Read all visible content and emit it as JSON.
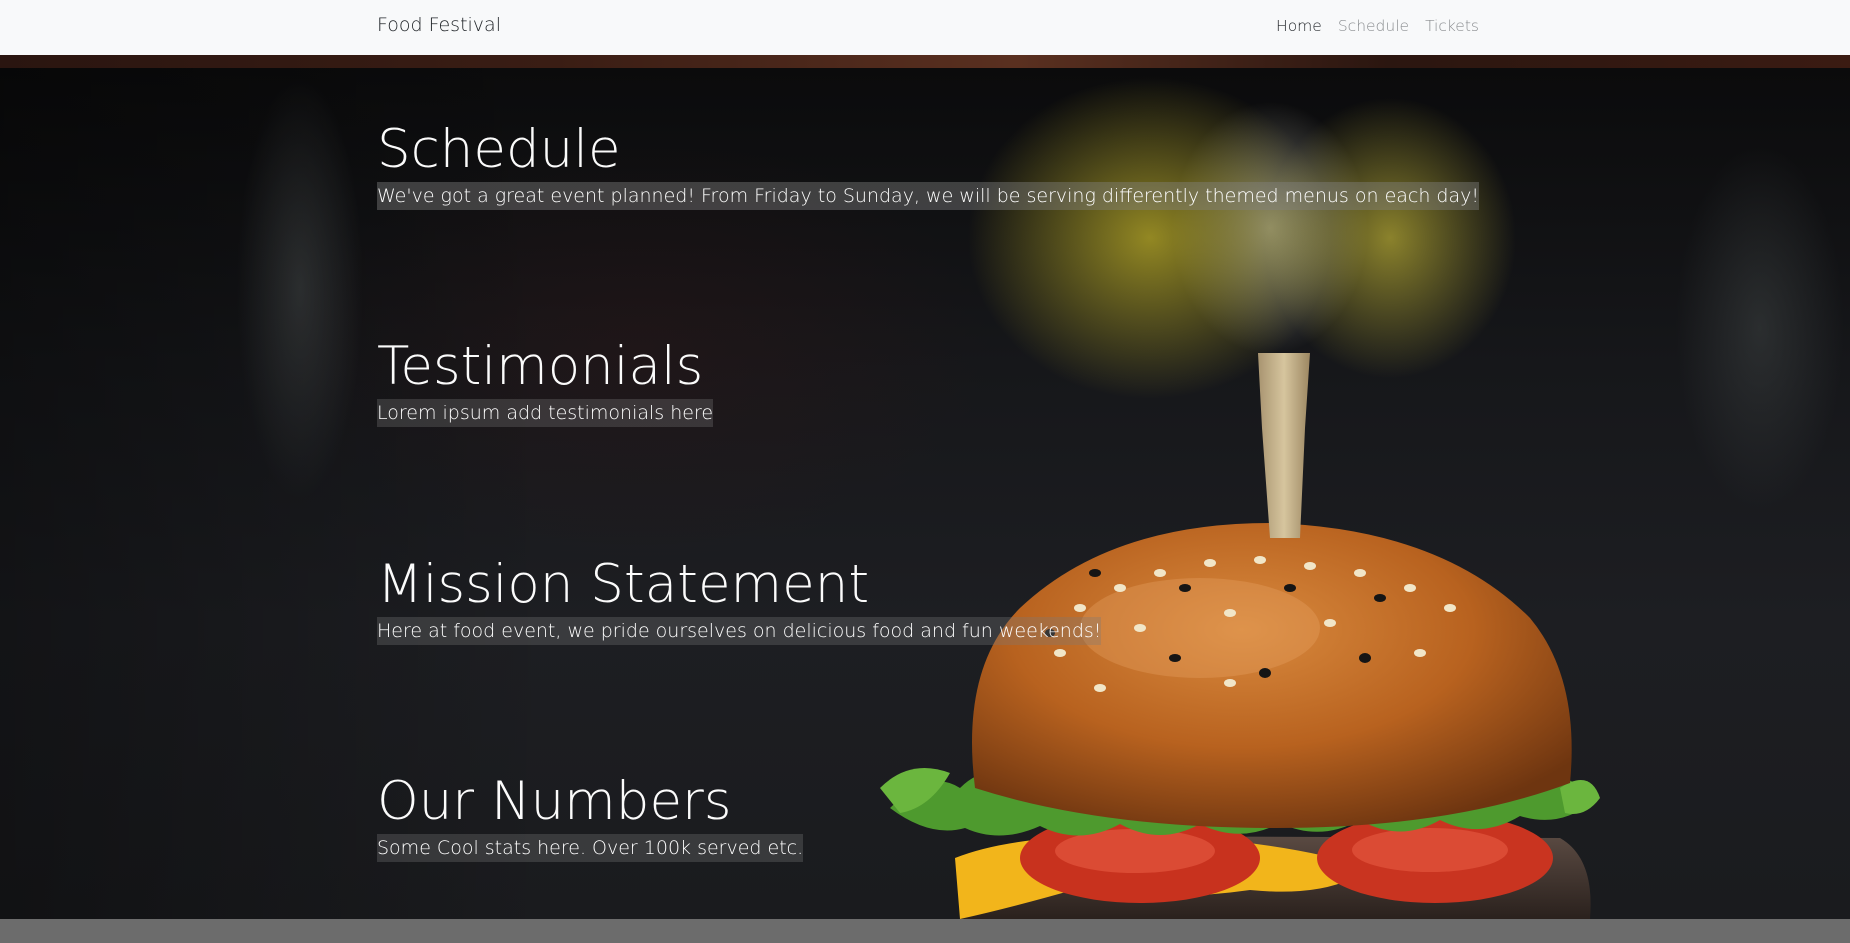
{
  "navbar": {
    "brand": "Food Festival",
    "links": [
      {
        "label": "Home",
        "active": true
      },
      {
        "label": "Schedule",
        "active": false
      },
      {
        "label": "Tickets",
        "active": false
      }
    ]
  },
  "sections": {
    "schedule": {
      "title": "Schedule",
      "text": "We've got a great event planned! From Friday to Sunday, we will be serving differently themed menus on each day!"
    },
    "testimonials": {
      "title": "Testimonials",
      "text": "Lorem ipsum add testimonials here"
    },
    "mission": {
      "title": "Mission Statement",
      "text": "Here at food event, we pride ourselves on delicious food and fun weekends!"
    },
    "numbers": {
      "title": "Our Numbers",
      "text": "Some Cool stats here. Over 100k served etc."
    }
  },
  "colors": {
    "navbar_bg": "#f8f9fa",
    "hero_dark": "#1b1c1f",
    "footer": "#6c6c6c",
    "bun": "#b8621f",
    "lettuce": "#4e9a2e",
    "tomato": "#c8321e",
    "cheese": "#f2b51b"
  },
  "images": {
    "hero_background": "burger-photo"
  }
}
